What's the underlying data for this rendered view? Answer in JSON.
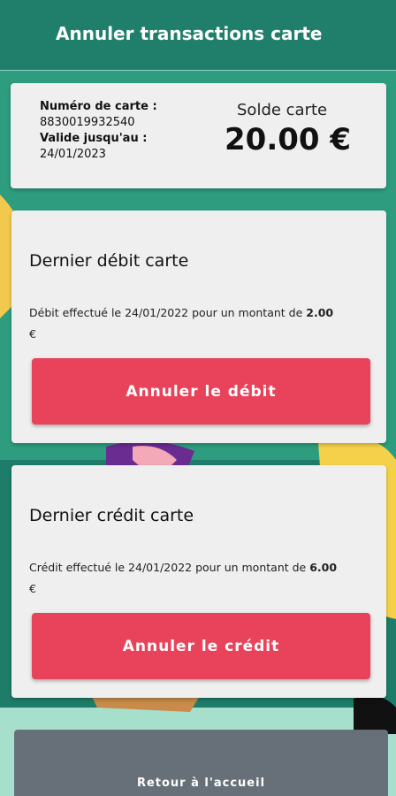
{
  "appbar": {
    "title": "Annuler transactions carte"
  },
  "card_info": {
    "number_label": "Numéro de carte :",
    "number_value": "8830019932540",
    "valid_label": "Valide jusqu'au :",
    "valid_value": "24/01/2023",
    "balance_label": "Solde carte",
    "balance_value": "20.00 €"
  },
  "debit": {
    "title": "Dernier débit carte",
    "desc_prefix": "Débit effectué le 24/01/2022 pour un montant de ",
    "amount": "2.00",
    "currency": "€",
    "button_label": "Annuler le débit"
  },
  "credit": {
    "title": "Dernier crédit carte",
    "desc_prefix": "Crédit effectué le 24/01/2022 pour un montant de ",
    "amount": "6.00",
    "currency": "€",
    "button_label": "Annuler le crédit"
  },
  "footer": {
    "home_button_label": "Retour à l'accueil"
  },
  "colors": {
    "appbar": "#1f7f6b",
    "background": "#2e9d7f",
    "danger_button": "#e8435a",
    "home_button": "#677078",
    "card": "#efefef"
  }
}
